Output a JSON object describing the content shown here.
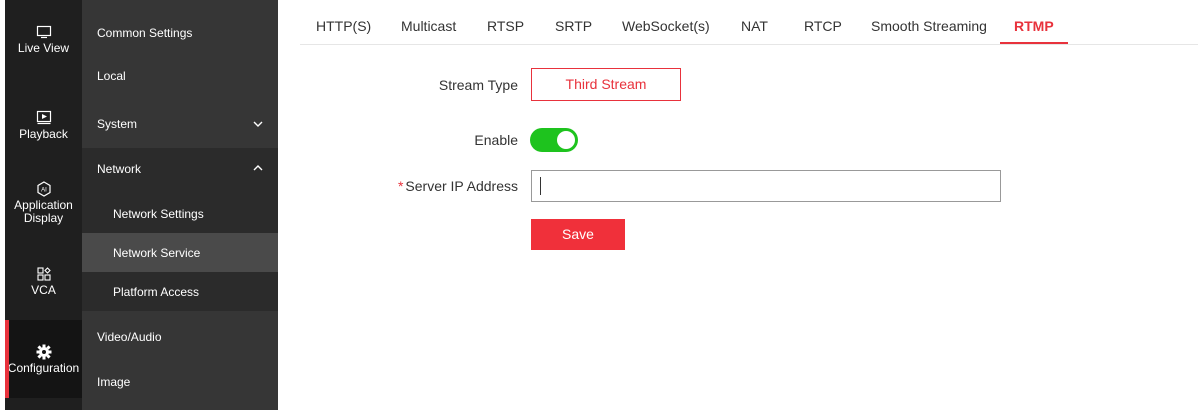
{
  "rail": {
    "items": [
      {
        "label": "Live View",
        "icon": "monitor-icon"
      },
      {
        "label": "Playback",
        "icon": "playback-icon"
      },
      {
        "label": "Application Display",
        "icon": "ai-icon"
      },
      {
        "label": "VCA",
        "icon": "vca-grid-icon"
      },
      {
        "label": "Configuration",
        "icon": "gear-icon"
      }
    ],
    "active": "Configuration"
  },
  "menu": {
    "common_settings": "Common Settings",
    "local": "Local",
    "system": "System",
    "network": "Network",
    "network_settings": "Network Settings",
    "network_service": "Network Service",
    "platform_access": "Platform Access",
    "video_audio": "Video/Audio",
    "image": "Image"
  },
  "tabs": [
    "HTTP(S)",
    "Multicast",
    "RTSP",
    "SRTP",
    "WebSocket(s)",
    "NAT",
    "RTCP",
    "Smooth Streaming",
    "RTMP"
  ],
  "active_tab": "RTMP",
  "form": {
    "stream_type_label": "Stream Type",
    "stream_type_value": "Third Stream",
    "enable_label": "Enable",
    "enable_state": true,
    "required_mark": "*",
    "server_ip_label": "Server IP Address",
    "server_ip_value": "",
    "save_label": "Save"
  },
  "colors": {
    "accent": "#e8323c",
    "toggle_on": "#1ec31e",
    "rail_bg": "#1f1f1f",
    "menu_bg": "#363636"
  }
}
